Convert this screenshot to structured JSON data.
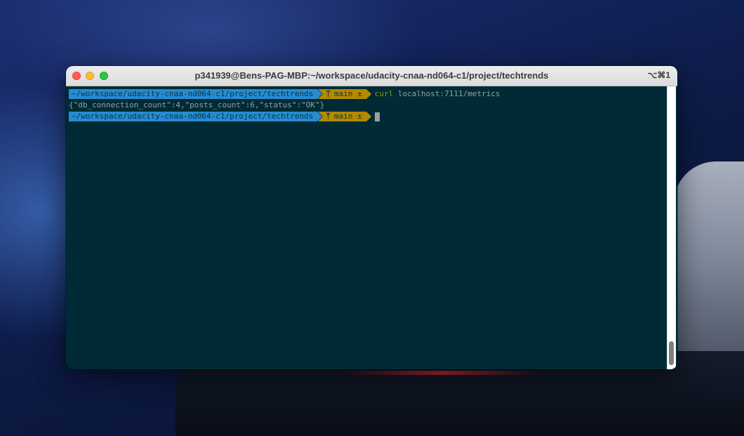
{
  "window": {
    "title": "p341939@Bens-PAG-MBP:~/workspace/udacity-cnaa-nd064-c1/project/techtrends",
    "shortcut": "⌥⌘1"
  },
  "terminal": {
    "prompt": {
      "path": "~/workspace/udacity-cnaa-nd064-c1/project/techtrends",
      "branch_icon": "ᛘ",
      "branch": "main ±"
    },
    "command": {
      "name": "curl",
      "args": "localhost:7111/metrics"
    },
    "output": "{\"db_connection_count\":4,\"posts_count\":6,\"status\":\"OK\"}"
  },
  "colors": {
    "terminal_bg": "#002b36",
    "prompt_dir_bg": "#268bd2",
    "prompt_git_bg": "#b58900",
    "command_color": "#859900"
  }
}
